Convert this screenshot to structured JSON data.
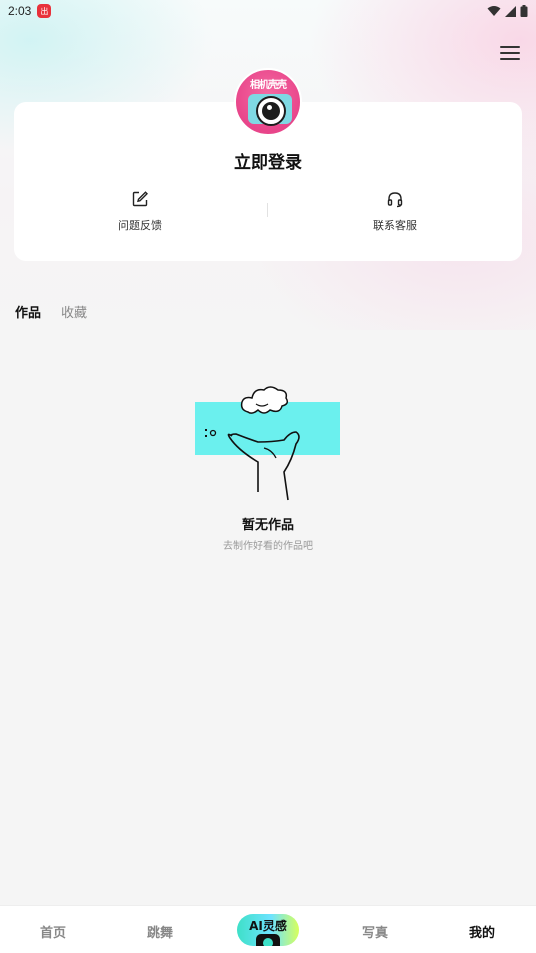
{
  "status_bar": {
    "time": "2:03",
    "badge": "出"
  },
  "profile": {
    "avatar_text": "相机壳壳",
    "login_label": "立即登录"
  },
  "actions": [
    {
      "label": "问题反馈",
      "icon": "edit-icon"
    },
    {
      "label": "联系客服",
      "icon": "headset-icon"
    }
  ],
  "tabs": [
    {
      "label": "作品",
      "active": true
    },
    {
      "label": "收藏",
      "active": false
    }
  ],
  "empty_state": {
    "title": "暂无作品",
    "subtitle": "去制作好看的作品吧"
  },
  "bottom_nav": {
    "items": [
      {
        "label": "首页",
        "active": false
      },
      {
        "label": "跳舞",
        "active": false
      },
      {
        "label": "AI灵感",
        "active": false
      },
      {
        "label": "写真",
        "active": false
      },
      {
        "label": "我的",
        "active": true
      }
    ]
  },
  "colors": {
    "accent_cyan": "#6bf0ee",
    "avatar_pink": "#e8458a",
    "background": "#f5f5f5"
  }
}
